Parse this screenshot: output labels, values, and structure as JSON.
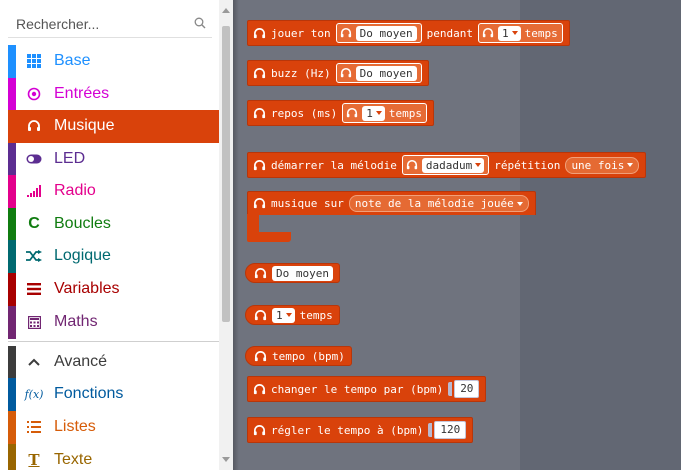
{
  "search": {
    "placeholder": "Rechercher..."
  },
  "toolbox": {
    "categories": [
      {
        "label": "Base",
        "icon": "grid-icon",
        "color": "#1e90ff",
        "text_color": "#1e90ff"
      },
      {
        "label": "Entrées",
        "icon": "target-icon",
        "color": "#d400d4",
        "text_color": "#d400d4"
      },
      {
        "label": "Musique",
        "icon": "headphones-icon",
        "color": "#d9420b",
        "text_color": "#ffffff",
        "selected": true
      },
      {
        "label": "LED",
        "icon": "toggle-icon",
        "color": "#5c2d91",
        "text_color": "#5c2d91"
      },
      {
        "label": "Radio",
        "icon": "signal-bars-icon",
        "color": "#e3008c",
        "text_color": "#e3008c"
      },
      {
        "label": "Boucles",
        "icon": "refresh-icon",
        "color": "#107c10",
        "text_color": "#107c10"
      },
      {
        "label": "Logique",
        "icon": "shuffle-icon",
        "color": "#006970",
        "text_color": "#006970"
      },
      {
        "label": "Variables",
        "icon": "list-lines-icon",
        "color": "#a80000",
        "text_color": "#a80000"
      },
      {
        "label": "Maths",
        "icon": "calculator-icon",
        "color": "#712672",
        "text_color": "#712672"
      }
    ],
    "advanced": [
      {
        "label": "Avancé",
        "icon": "chevron-up-icon",
        "color": "#3c3c3c",
        "text_color": "#3c3c3c"
      },
      {
        "label": "Fonctions",
        "icon": "function-icon",
        "color": "#005a9e",
        "text_color": "#005a9e"
      },
      {
        "label": "Listes",
        "icon": "list-icon",
        "color": "#d65c09",
        "text_color": "#d65c09"
      },
      {
        "label": "Texte",
        "icon": "text-icon",
        "color": "#996600",
        "text_color": "#996600"
      }
    ]
  },
  "blocks": {
    "play_tone": {
      "text1": "jouer ton",
      "note": "Do moyen",
      "text2": "pendant",
      "beats": "1",
      "text3": "temps"
    },
    "ring_tone": {
      "text": "buzz (Hz)",
      "note": "Do moyen"
    },
    "rest": {
      "text": "repos (ms)",
      "beats": "1",
      "text2": "temps"
    },
    "start_melody": {
      "text1": "démarrer la mélodie",
      "melody": "dadadum",
      "text2": "répétition",
      "repeat": "une fois"
    },
    "on_music": {
      "text": "musique sur",
      "event": "note de la mélodie jouée"
    },
    "note_value": {
      "note": "Do moyen"
    },
    "beat_value": {
      "beats": "1",
      "text": "temps"
    },
    "tempo": {
      "text": "tempo (bpm)"
    },
    "change_tempo": {
      "text": "changer le tempo par (bpm)",
      "value": "20"
    },
    "set_tempo": {
      "text": "régler le tempo à (bpm)",
      "value": "120"
    }
  },
  "colors": {
    "music": "#d9420b",
    "flyout_bg": "#6f737e",
    "workspace_bg": "#626773"
  }
}
